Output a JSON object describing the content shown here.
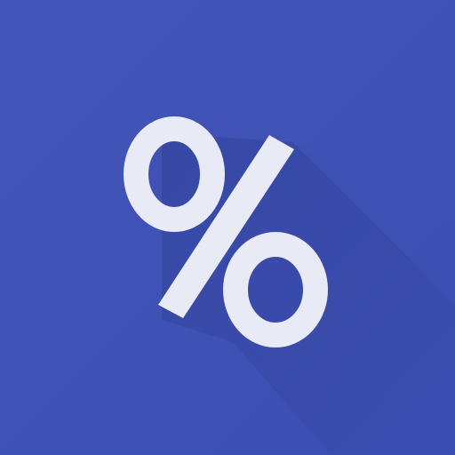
{
  "icon": {
    "name": "percent-icon",
    "glyph": "%",
    "colors": {
      "background": "#3f51b5",
      "long_shadow": "#33449c",
      "symbol": "#e8eaf6"
    }
  }
}
